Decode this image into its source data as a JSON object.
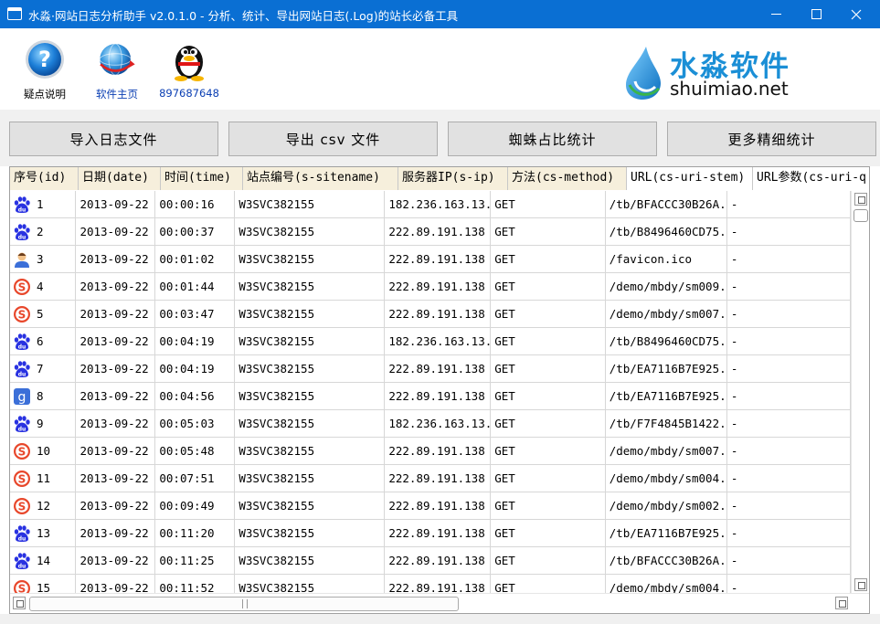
{
  "window": {
    "title": "水淼·网站日志分析助手 v2.0.1.0 - 分析、统计、导出网站日志(.Log)的站长必备工具",
    "controls": {
      "minimize": "—",
      "maximize": "☐",
      "close": "✕"
    }
  },
  "toolbar": {
    "help_label": "疑点说明",
    "home_label": "软件主页",
    "qq_label": "897687648"
  },
  "logo": {
    "name_cn": "水淼软件",
    "domain": "shuimiao.net"
  },
  "actions": {
    "import_label": "导入日志文件",
    "export_label": "导出 csv 文件",
    "spider_label": "蜘蛛占比统计",
    "more_label": "更多精细统计"
  },
  "table": {
    "columns": [
      "序号(id)",
      "日期(date)",
      "时间(time)",
      "站点编号(s-sitename)",
      "服务器IP(s-ip)",
      "方法(cs-method)",
      "URL(cs-uri-stem)",
      "URL参数(cs-uri-q"
    ],
    "rows": [
      {
        "agent": "baidu-spider-icon",
        "id": "1",
        "date": "2013-09-22",
        "time": "00:00:16",
        "site": "W3SVC382155",
        "ip": "182.236.163.13.",
        "method": "GET",
        "url": "/tb/BFACCC30B26A.",
        "query": "-"
      },
      {
        "agent": "baidu-spider-icon",
        "id": "2",
        "date": "2013-09-22",
        "time": "00:00:37",
        "site": "W3SVC382155",
        "ip": "222.89.191.138",
        "method": "GET",
        "url": "/tb/B8496460CD75.",
        "query": "-"
      },
      {
        "agent": "user-visitor-icon",
        "id": "3",
        "date": "2013-09-22",
        "time": "00:01:02",
        "site": "W3SVC382155",
        "ip": "222.89.191.138",
        "method": "GET",
        "url": "/favicon.ico",
        "query": "-"
      },
      {
        "agent": "sogou-spider-icon",
        "id": "4",
        "date": "2013-09-22",
        "time": "00:01:44",
        "site": "W3SVC382155",
        "ip": "222.89.191.138",
        "method": "GET",
        "url": "/demo/mbdy/sm009.",
        "query": "-"
      },
      {
        "agent": "sogou-spider-icon",
        "id": "5",
        "date": "2013-09-22",
        "time": "00:03:47",
        "site": "W3SVC382155",
        "ip": "222.89.191.138",
        "method": "GET",
        "url": "/demo/mbdy/sm007.",
        "query": "-"
      },
      {
        "agent": "baidu-spider-icon",
        "id": "6",
        "date": "2013-09-22",
        "time": "00:04:19",
        "site": "W3SVC382155",
        "ip": "182.236.163.13.",
        "method": "GET",
        "url": "/tb/B8496460CD75.",
        "query": "-"
      },
      {
        "agent": "baidu-spider-icon",
        "id": "7",
        "date": "2013-09-22",
        "time": "00:04:19",
        "site": "W3SVC382155",
        "ip": "222.89.191.138",
        "method": "GET",
        "url": "/tb/EA7116B7E925.",
        "query": "-"
      },
      {
        "agent": "google-spider-icon",
        "id": "8",
        "date": "2013-09-22",
        "time": "00:04:56",
        "site": "W3SVC382155",
        "ip": "222.89.191.138",
        "method": "GET",
        "url": "/tb/EA7116B7E925.",
        "query": "-"
      },
      {
        "agent": "baidu-spider-icon",
        "id": "9",
        "date": "2013-09-22",
        "time": "00:05:03",
        "site": "W3SVC382155",
        "ip": "182.236.163.13.",
        "method": "GET",
        "url": "/tb/F7F4845B1422.",
        "query": "-"
      },
      {
        "agent": "sogou-spider-icon",
        "id": "10",
        "date": "2013-09-22",
        "time": "00:05:48",
        "site": "W3SVC382155",
        "ip": "222.89.191.138",
        "method": "GET",
        "url": "/demo/mbdy/sm007.",
        "query": "-"
      },
      {
        "agent": "sogou-spider-icon",
        "id": "11",
        "date": "2013-09-22",
        "time": "00:07:51",
        "site": "W3SVC382155",
        "ip": "222.89.191.138",
        "method": "GET",
        "url": "/demo/mbdy/sm004.",
        "query": "-"
      },
      {
        "agent": "sogou-spider-icon",
        "id": "12",
        "date": "2013-09-22",
        "time": "00:09:49",
        "site": "W3SVC382155",
        "ip": "222.89.191.138",
        "method": "GET",
        "url": "/demo/mbdy/sm002.",
        "query": "-"
      },
      {
        "agent": "baidu-spider-icon",
        "id": "13",
        "date": "2013-09-22",
        "time": "00:11:20",
        "site": "W3SVC382155",
        "ip": "222.89.191.138",
        "method": "GET",
        "url": "/tb/EA7116B7E925.",
        "query": "-"
      },
      {
        "agent": "baidu-spider-icon",
        "id": "14",
        "date": "2013-09-22",
        "time": "00:11:25",
        "site": "W3SVC382155",
        "ip": "222.89.191.138",
        "method": "GET",
        "url": "/tb/BFACCC30B26A.",
        "query": "-"
      },
      {
        "agent": "sogou-spider-icon",
        "id": "15",
        "date": "2013-09-22",
        "time": "00:11:52",
        "site": "W3SVC382155",
        "ip": "222.89.191.138",
        "method": "GET",
        "url": "/demo/mbdy/sm004.",
        "query": "-"
      }
    ]
  },
  "colors": {
    "titlebar": "#0a6fd3",
    "header_tint": "#f6efdc",
    "baidu": "#2932e1",
    "sogou": "#e8472b",
    "google": "#3b6fd8",
    "link_blue": "#0b3fb3",
    "logo_blue": "#1b8fd6"
  }
}
